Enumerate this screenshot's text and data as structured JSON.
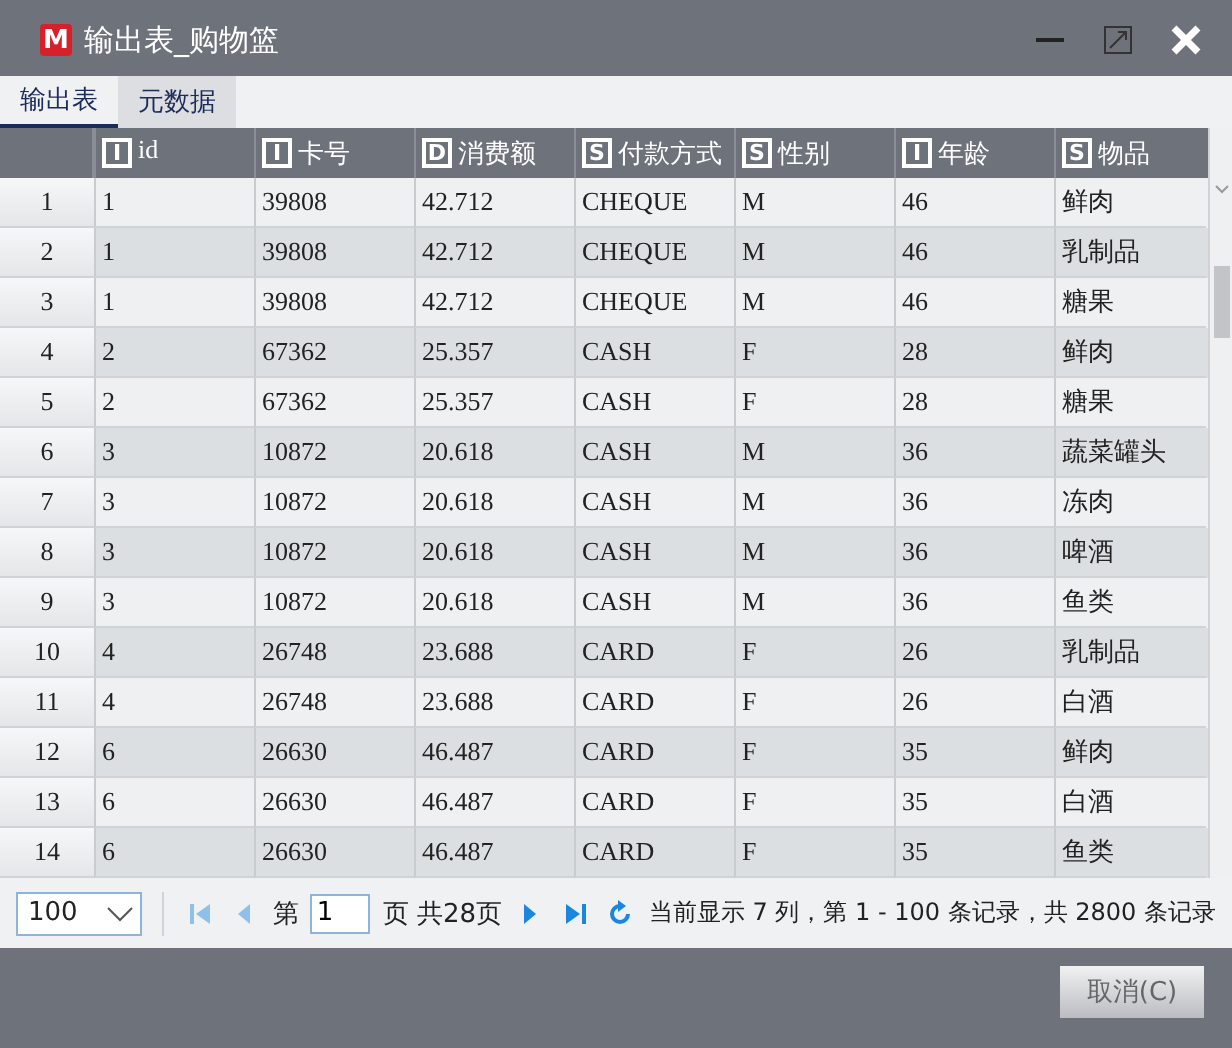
{
  "window": {
    "logo": "M",
    "title": "输出表_购物篮"
  },
  "tabs": [
    {
      "label": "输出表",
      "selected": true
    },
    {
      "label": "元数据",
      "selected": false
    }
  ],
  "table": {
    "columns": [
      {
        "type": "I",
        "label": "id"
      },
      {
        "type": "I",
        "label": "卡号"
      },
      {
        "type": "D",
        "label": "消费额"
      },
      {
        "type": "S",
        "label": "付款方式"
      },
      {
        "type": "S",
        "label": "性别"
      },
      {
        "type": "I",
        "label": "年龄"
      },
      {
        "type": "S",
        "label": "物品"
      }
    ],
    "rows": [
      {
        "number": "1",
        "cells": [
          "1",
          "39808",
          "42.712",
          "CHEQUE",
          "M",
          "46",
          "鲜肉"
        ]
      },
      {
        "number": "2",
        "cells": [
          "1",
          "39808",
          "42.712",
          "CHEQUE",
          "M",
          "46",
          "乳制品"
        ]
      },
      {
        "number": "3",
        "cells": [
          "1",
          "39808",
          "42.712",
          "CHEQUE",
          "M",
          "46",
          "糖果"
        ]
      },
      {
        "number": "4",
        "cells": [
          "2",
          "67362",
          "25.357",
          "CASH",
          "F",
          "28",
          "鲜肉"
        ]
      },
      {
        "number": "5",
        "cells": [
          "2",
          "67362",
          "25.357",
          "CASH",
          "F",
          "28",
          "糖果"
        ]
      },
      {
        "number": "6",
        "cells": [
          "3",
          "10872",
          "20.618",
          "CASH",
          "M",
          "36",
          "蔬菜罐头"
        ]
      },
      {
        "number": "7",
        "cells": [
          "3",
          "10872",
          "20.618",
          "CASH",
          "M",
          "36",
          "冻肉"
        ]
      },
      {
        "number": "8",
        "cells": [
          "3",
          "10872",
          "20.618",
          "CASH",
          "M",
          "36",
          "啤酒"
        ]
      },
      {
        "number": "9",
        "cells": [
          "3",
          "10872",
          "20.618",
          "CASH",
          "M",
          "36",
          "鱼类"
        ]
      },
      {
        "number": "10",
        "cells": [
          "4",
          "26748",
          "23.688",
          "CARD",
          "F",
          "26",
          "乳制品"
        ]
      },
      {
        "number": "11",
        "cells": [
          "4",
          "26748",
          "23.688",
          "CARD",
          "F",
          "26",
          "白酒"
        ]
      },
      {
        "number": "12",
        "cells": [
          "6",
          "26630",
          "46.487",
          "CARD",
          "F",
          "35",
          "鲜肉"
        ]
      },
      {
        "number": "13",
        "cells": [
          "6",
          "26630",
          "46.487",
          "CARD",
          "F",
          "35",
          "白酒"
        ]
      },
      {
        "number": "14",
        "cells": [
          "6",
          "26630",
          "46.487",
          "CARD",
          "F",
          "35",
          "鱼类"
        ]
      }
    ]
  },
  "pager": {
    "page_size": "100",
    "page_prefix": "第",
    "page": "1",
    "page_suffix": "页 共28页",
    "status": "当前显示 7 列，第 1 - 100 条记录，共 2800 条记录"
  },
  "buttons": [
    {
      "label": "取消(C)"
    }
  ]
}
